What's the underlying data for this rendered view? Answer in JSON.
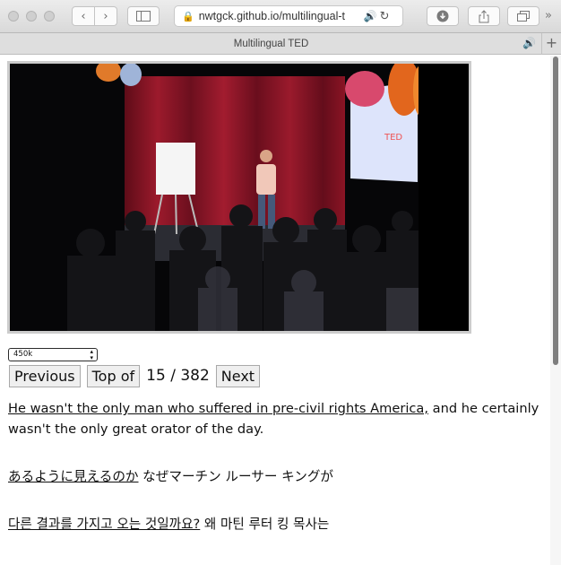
{
  "browser": {
    "address_url": "nwtgck.github.io/multilingual-t",
    "tab_title": "Multilingual TED",
    "icons": {
      "back": "chevron-left-icon",
      "forward": "chevron-right-icon",
      "sidebar": "sidebar-icon",
      "lock": "lock-icon",
      "audio": "speaker-icon",
      "reload": "reload-icon",
      "downloads": "download-icon",
      "share": "share-icon",
      "tabs": "tabs-overview-icon",
      "more": "chevrons-right-icon",
      "new_tab": "plus-icon"
    }
  },
  "player": {
    "quality_selected": "450k",
    "previous_label": "Previous",
    "top_label": "Top of",
    "current": "15",
    "separator": "/",
    "total": "382",
    "next_label": "Next"
  },
  "subtitles": {
    "en": {
      "highlight": "He wasn't the only man who suffered in pre-civil rights America,",
      "rest": "and he certainly wasn't the only great orator of the day."
    },
    "ja": {
      "highlight": "あるように見えるのか",
      "rest": "なぜマーチン ルーサー キングが"
    },
    "ko": {
      "highlight": "다른 결과를 가지고 오는 것일까요?",
      "rest": "왜 마틴 루터 킹 목사는"
    }
  },
  "colors": {
    "curtain": "#8a1424",
    "stage_dark": "#050506",
    "screen_blue": "#dfe6ff"
  }
}
